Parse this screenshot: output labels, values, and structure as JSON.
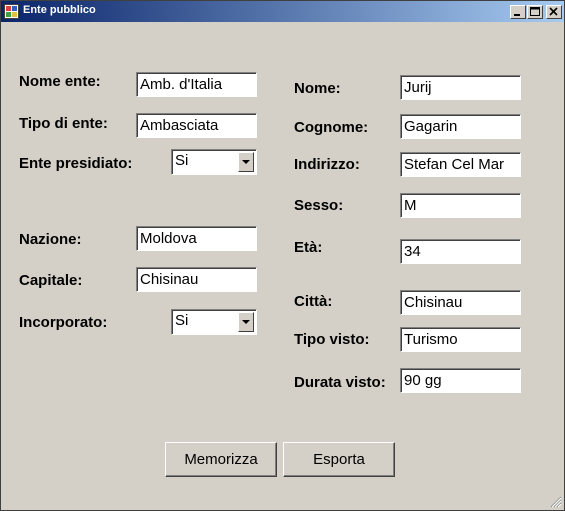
{
  "window": {
    "title": "Ente pubblico",
    "icon": "form-app-icon"
  },
  "left": {
    "nome_ente": {
      "label": "Nome ente:",
      "value": "Amb. d'Italia"
    },
    "tipo_ente": {
      "label": "Tipo di ente:",
      "value": "Ambasciata"
    },
    "ente_presidiato": {
      "label": "Ente presidiato:",
      "value": "Si"
    },
    "nazione": {
      "label": "Nazione:",
      "value": "Moldova"
    },
    "capitale": {
      "label": "Capitale:",
      "value": "Chisinau"
    },
    "incorporato": {
      "label": "Incorporato:",
      "value": "Si"
    }
  },
  "right": {
    "nome": {
      "label": "Nome:",
      "value": "Jurij"
    },
    "cognome": {
      "label": "Cognome:",
      "value": "Gagarin"
    },
    "indirizzo": {
      "label": "Indirizzo:",
      "value": "Stefan Cel Mar"
    },
    "sesso": {
      "label": "Sesso:",
      "value": "M"
    },
    "eta": {
      "label": "Età:",
      "value": "34"
    },
    "citta": {
      "label": "Città:",
      "value": "Chisinau"
    },
    "tipo_visto": {
      "label": "Tipo visto:",
      "value": "Turismo"
    },
    "durata_visto": {
      "label": "Durata visto:",
      "value": "90 gg"
    }
  },
  "buttons": {
    "memorizza": "Memorizza",
    "esporta": "Esporta"
  }
}
